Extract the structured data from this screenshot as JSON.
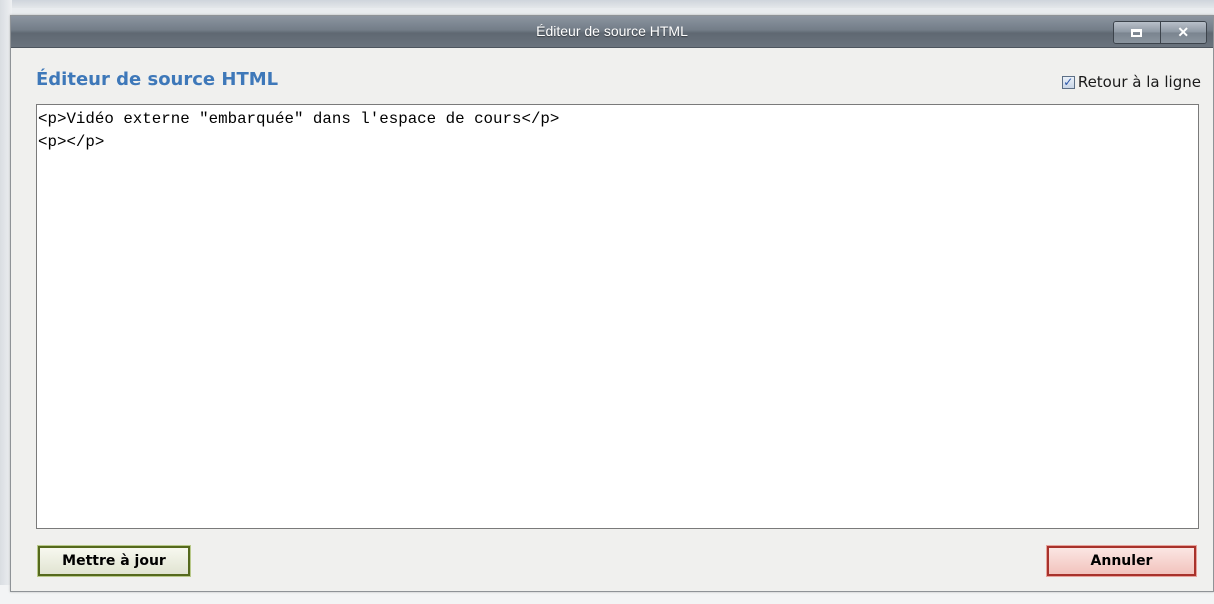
{
  "dialog": {
    "title": "Éditeur de source HTML",
    "heading": "Éditeur de source HTML",
    "window_buttons": [
      {
        "name": "maximize",
        "icon": "maximize-icon"
      },
      {
        "name": "close",
        "icon": "close-icon",
        "glyph": "✕"
      }
    ]
  },
  "wrap_option": {
    "label": "Retour à la ligne",
    "checked": true
  },
  "editor": {
    "lines": [
      "<p>Vidéo externe \"embarquée\" dans l'espace de cours</p>",
      "<p></p>"
    ]
  },
  "buttons": {
    "update_label": "Mettre à jour",
    "cancel_label": "Annuler"
  },
  "colors": {
    "heading": "#3e78b9",
    "titlebar": "#737d88",
    "update_border": "#55691d",
    "cancel_border": "#a8322b"
  }
}
